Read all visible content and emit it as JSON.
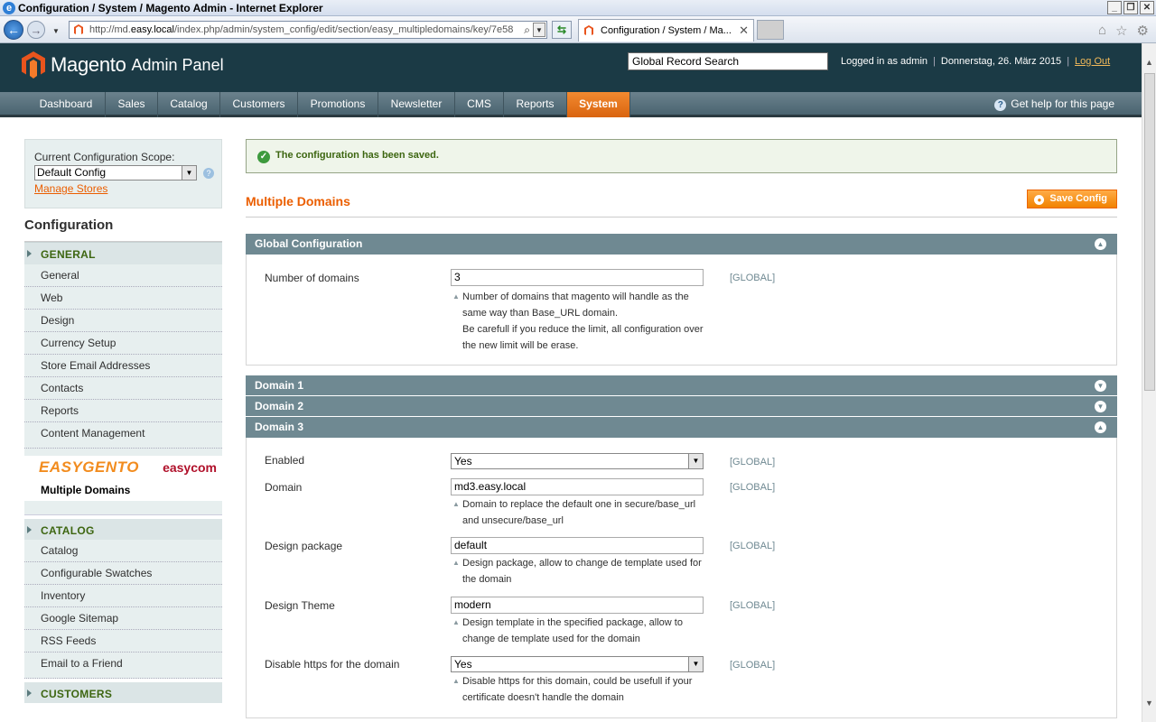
{
  "browser": {
    "window_title": "Configuration / System / Magento Admin - Internet Explorer",
    "url_prefix": "http://md.",
    "url_host": "easy.local",
    "url_rest": "/index.php/admin/system_config/edit/section/easy_multipledomains/key/7e58",
    "tab_title": "Configuration / System / Ma...",
    "accent": "#1f5faa"
  },
  "header": {
    "logo_word": "Magento",
    "logo_suffix": "Admin Panel",
    "search_placeholder": "Global Record Search",
    "logged_in": "Logged in as admin",
    "date": "Donnerstag, 26. März 2015",
    "logout": "Log Out"
  },
  "nav": {
    "items": [
      "Dashboard",
      "Sales",
      "Catalog",
      "Customers",
      "Promotions",
      "Newsletter",
      "CMS",
      "Reports",
      "System"
    ],
    "active": "System",
    "help": "Get help for this page",
    "active_color": "#eb6a12"
  },
  "sidebar": {
    "scope_label": "Current Configuration Scope:",
    "scope_value": "Default Config",
    "manage_stores": "Manage Stores",
    "title": "Configuration",
    "general_header": "GENERAL",
    "general_items": [
      "General",
      "Web",
      "Design",
      "Currency Setup",
      "Store Email Addresses",
      "Contacts",
      "Reports",
      "Content Management"
    ],
    "banner_left": "EASYGENTO",
    "banner_right": "easycom",
    "extension_item": "Multiple Domains",
    "catalog_header": "CATALOG",
    "catalog_items": [
      "Catalog",
      "Configurable Swatches",
      "Inventory",
      "Google Sitemap",
      "RSS Feeds",
      "Email to a Friend"
    ],
    "customers_header": "CUSTOMERS"
  },
  "main": {
    "success_message": "The configuration has been saved.",
    "page_title": "Multiple Domains",
    "save_button": "Save Config",
    "global_section": {
      "title": "Global Configuration",
      "field_label": "Number of domains",
      "field_value": "3",
      "scope": "[GLOBAL]",
      "note_lines": [
        "Number of domains that magento will handle as the",
        "same way than Base_URL domain.",
        "Be carefull if you reduce the limit, all configuration over",
        "the new limit will be erase."
      ]
    },
    "domain1": "Domain 1",
    "domain2": "Domain 2",
    "domain3": {
      "title": "Domain 3",
      "enabled_label": "Enabled",
      "enabled_value": "Yes",
      "domain_label": "Domain",
      "domain_value": "md3.easy.local",
      "domain_note": [
        "Domain to replace the default one in secure/base_url",
        "and unsecure/base_url"
      ],
      "package_label": "Design package",
      "package_value": "default",
      "package_note": [
        "Design package, allow to change de template used for",
        "the domain"
      ],
      "theme_label": "Design Theme",
      "theme_value": "modern",
      "theme_note": [
        "Design template in the specified package, allow to",
        "change de template used for the domain"
      ],
      "https_label": "Disable https for the domain",
      "https_value": "Yes",
      "https_note": [
        "Disable https for this domain, could be usefull if your",
        "certificate doesn't handle the domain"
      ],
      "scope": "[GLOBAL]"
    }
  }
}
